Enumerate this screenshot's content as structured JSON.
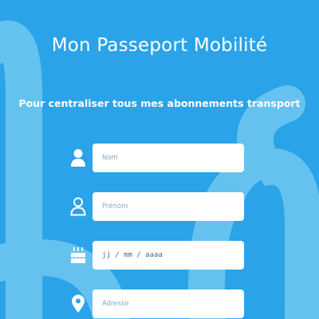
{
  "header": {
    "title": "Mon Passeport Mobilité",
    "subtitle": "Pour centraliser tous mes abonnements transport"
  },
  "form": {
    "fields": [
      {
        "name": "nom",
        "icon": "user-icon",
        "placeholder": "Nom"
      },
      {
        "name": "prenom",
        "icon": "user-outline-icon",
        "placeholder": "Prénom"
      },
      {
        "name": "date_naissance",
        "icon": "birthday-cake-icon",
        "placeholder": "jj / mm / aaaa"
      },
      {
        "name": "adresse",
        "icon": "map-marker-icon",
        "placeholder": "Adresse"
      }
    ]
  },
  "colors": {
    "background": "#2aa3e8",
    "decor": "#6cc6f0",
    "text": "#ffffff",
    "field_bg": "#ffffff",
    "placeholder": "#8aa7c8"
  }
}
